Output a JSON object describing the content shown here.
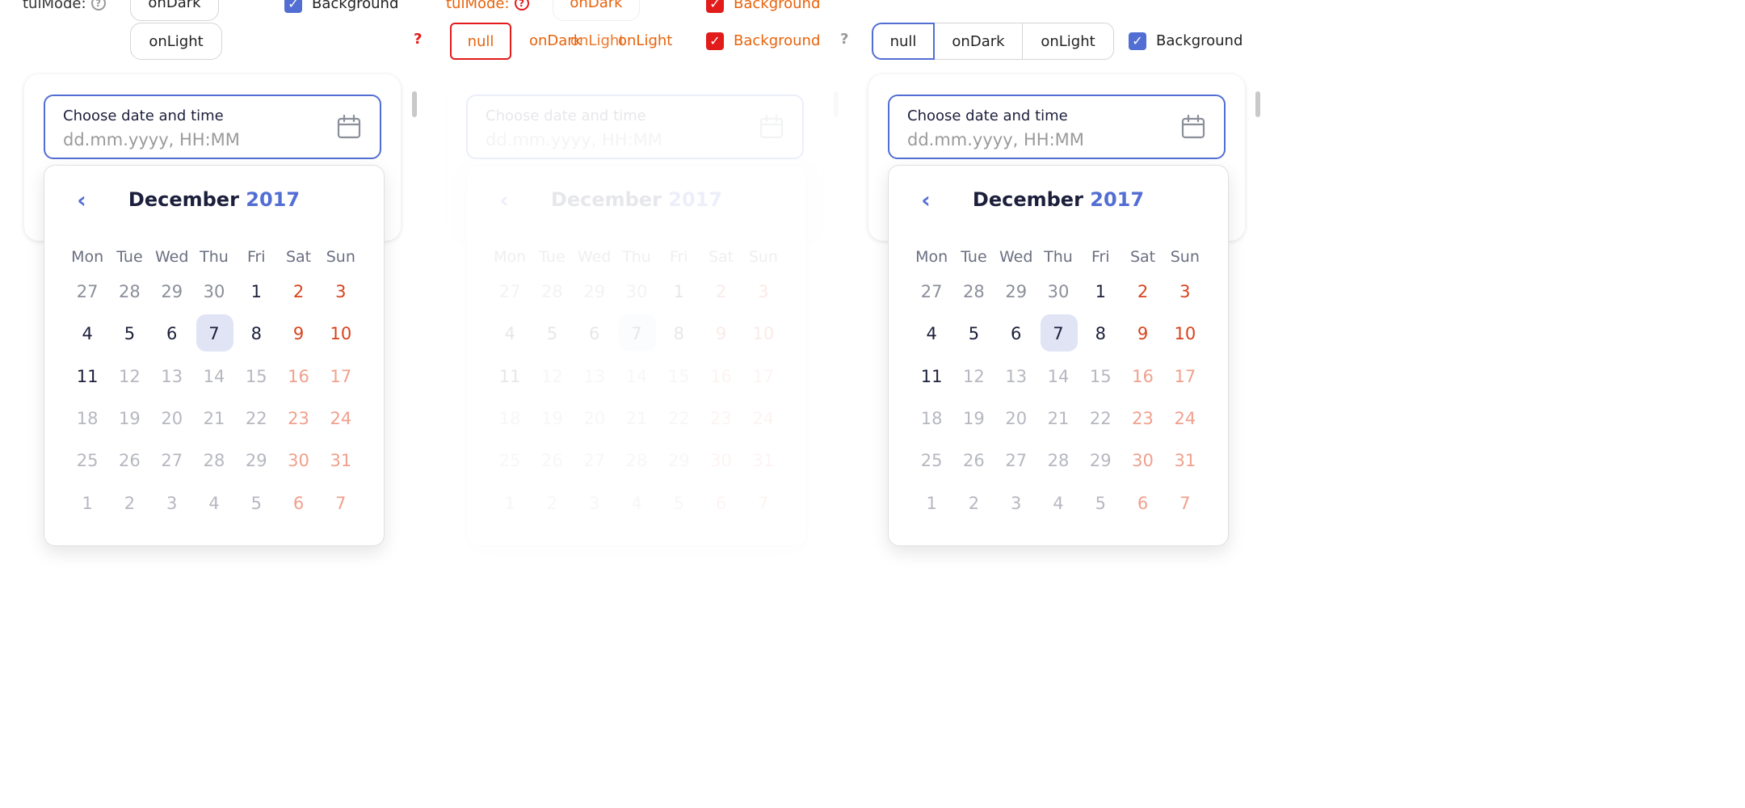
{
  "toolbar": {
    "mode_label": "tuiMode:",
    "help_glyph": "?",
    "options": [
      "null",
      "onDark",
      "onLight"
    ],
    "background_label": "Background",
    "check_glyph": "✓"
  },
  "datetime": {
    "label": "Choose date and time",
    "placeholder": "dd.mm.yyyy, HH:MM",
    "icon": "calendar-icon"
  },
  "calendar": {
    "prev_glyph": "‹",
    "month": "December",
    "year": "2017",
    "weekdays": [
      "Mon",
      "Tue",
      "Wed",
      "Thu",
      "Fri",
      "Sat",
      "Sun"
    ],
    "weeks": [
      [
        "27",
        "28",
        "29",
        "30",
        "1",
        "2",
        "3"
      ],
      [
        "4",
        "5",
        "6",
        "7",
        "8",
        "9",
        "10"
      ],
      [
        "11",
        "12",
        "13",
        "14",
        "15",
        "16",
        "17"
      ],
      [
        "18",
        "19",
        "20",
        "21",
        "22",
        "23",
        "24"
      ],
      [
        "25",
        "26",
        "27",
        "28",
        "29",
        "30",
        "31"
      ],
      [
        "1",
        "2",
        "3",
        "4",
        "5",
        "6",
        "7"
      ]
    ],
    "selected_day": "7"
  },
  "colors": {
    "accent": "#526ed3",
    "weekend": "#d8431d",
    "selected_bg": "#e0e4f5",
    "debug_red": "#e21b1b",
    "debug_orange": "#e8620a"
  }
}
